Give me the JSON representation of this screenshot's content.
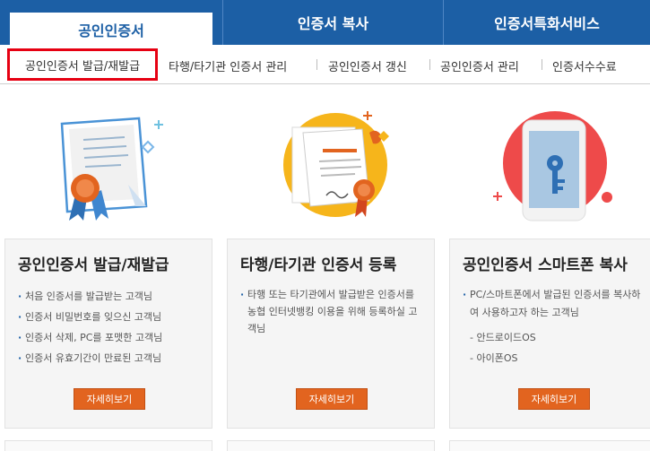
{
  "tabs": [
    {
      "label": "공인인증서"
    },
    {
      "label": "인증서 복사"
    },
    {
      "label": "인증서특화서비스"
    }
  ],
  "subnav": [
    {
      "label": "공인인증서 발급/재발급"
    },
    {
      "label": "타행/타기관 인증서 관리"
    },
    {
      "label": "공인인증서 갱신"
    },
    {
      "label": "공인인증서 관리"
    },
    {
      "label": "인증서수수료"
    }
  ],
  "cards": [
    {
      "title": "공인인증서 발급/재발급",
      "items": [
        "처음 인증서를 발급받는 고객님",
        "인증서 비밀번호를 잊으신 고객님",
        "인증서 삭제, PC를 포맷한 고객님",
        "인증서 유효기간이 만료된 고객님"
      ],
      "button": "자세히보기"
    },
    {
      "title": "타행/타기관 인증서 등록",
      "desc": "타행 또는 타기관에서 발급받은 인증서를 농협 인터넷뱅킹 이용을 위해 등록하실 고객님",
      "button": "자세히보기"
    },
    {
      "title": "공인인증서 스마트폰 복사",
      "items": [
        "PC/스마트폰에서 발급된 인증서를 복사하여 사용하고자 하는 고객님"
      ],
      "options": [
        "- 안드로이드OS",
        "- 아이폰OS"
      ],
      "button": "자세히보기"
    }
  ],
  "icons": [
    "certificate-ribbon-icon",
    "document-seal-icon",
    "smartphone-key-icon"
  ],
  "colors": {
    "tab_bg": "#1c5fa5",
    "button": "#e2641f",
    "highlight": "#e60012"
  }
}
